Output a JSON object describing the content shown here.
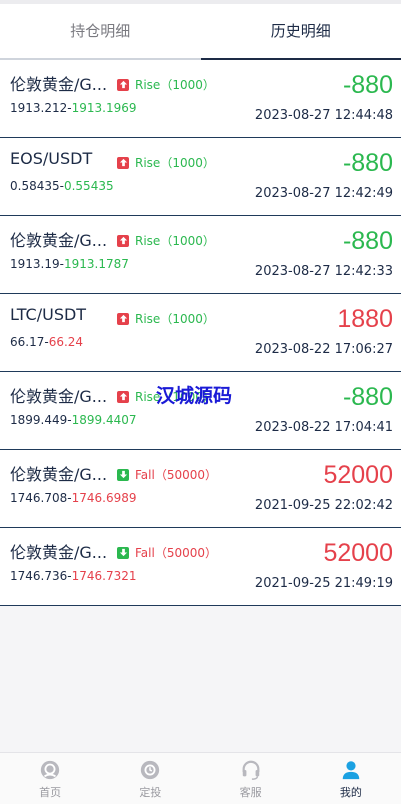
{
  "tabs": [
    {
      "label": "持仓明细",
      "active": false
    },
    {
      "label": "历史明细",
      "active": true
    }
  ],
  "rows": [
    {
      "symbol": "伦敦黄金/G...",
      "direction": "Rise",
      "amount": "（1000）",
      "open_price": "1913.212",
      "separator": "-",
      "close_price": "1913.1969",
      "close_color": "green",
      "pnl": "-880",
      "pnl_color": "green",
      "time": "2023-08-27 12:44:48"
    },
    {
      "symbol": "EOS/USDT",
      "direction": "Rise",
      "amount": "（1000）",
      "open_price": "0.58435",
      "separator": "-",
      "close_price": "0.55435",
      "close_color": "green",
      "pnl": "-880",
      "pnl_color": "green",
      "time": "2023-08-27 12:42:49"
    },
    {
      "symbol": "伦敦黄金/G...",
      "direction": "Rise",
      "amount": "（1000）",
      "open_price": "1913.19",
      "separator": "-",
      "close_price": "1913.1787",
      "close_color": "green",
      "pnl": "-880",
      "pnl_color": "green",
      "time": "2023-08-27 12:42:33"
    },
    {
      "symbol": "LTC/USDT",
      "direction": "Rise",
      "amount": "（1000）",
      "open_price": "66.17",
      "separator": "-",
      "close_price": "66.24",
      "close_color": "red",
      "pnl": "1880",
      "pnl_color": "red",
      "time": "2023-08-22 17:06:27"
    },
    {
      "symbol": "伦敦黄金/G...",
      "direction": "Rise",
      "amount": "（1000）",
      "open_price": "1899.449",
      "separator": "-",
      "close_price": "1899.4407",
      "close_color": "green",
      "pnl": "-880",
      "pnl_color": "green",
      "time": "2023-08-22 17:04:41"
    },
    {
      "symbol": "伦敦黄金/G...",
      "direction": "Fall",
      "amount": "（50000）",
      "open_price": "1746.708",
      "separator": "-",
      "close_price": "1746.6989",
      "close_color": "red",
      "pnl": "52000",
      "pnl_color": "red",
      "time": "2021-09-25 22:02:42"
    },
    {
      "symbol": "伦敦黄金/G...",
      "direction": "Fall",
      "amount": "（50000）",
      "open_price": "1746.736",
      "separator": "-",
      "close_price": "1746.7321",
      "close_color": "red",
      "pnl": "52000",
      "pnl_color": "red",
      "time": "2021-09-25 21:49:19"
    }
  ],
  "watermark": "汉城源码",
  "bottom_nav": [
    {
      "label": "首页",
      "icon": "home-icon",
      "active": false
    },
    {
      "label": "定投",
      "icon": "invest-icon",
      "active": false
    },
    {
      "label": "客服",
      "icon": "headset-icon",
      "active": false
    },
    {
      "label": "我的",
      "icon": "user-icon",
      "active": true
    }
  ],
  "colors": {
    "green": "#2bb84f",
    "red": "#e5414b",
    "navy": "#1d2b46",
    "accent": "#1ba1e2"
  }
}
